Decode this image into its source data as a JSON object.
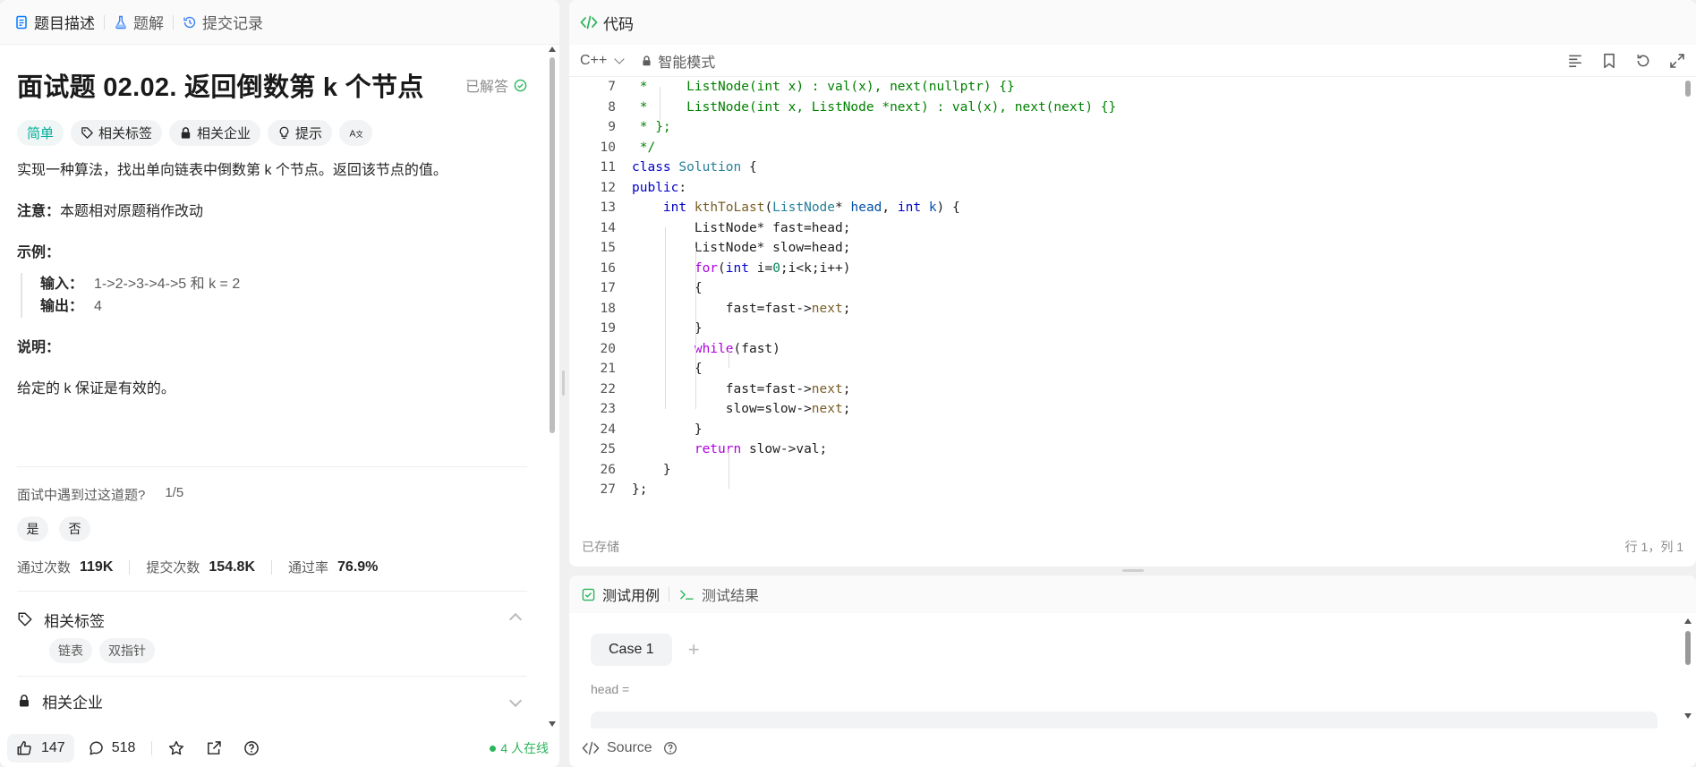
{
  "left_tabs": [
    {
      "label": "题目描述"
    },
    {
      "label": "题解"
    },
    {
      "label": "提交记录"
    }
  ],
  "problem": {
    "title": "面试题 02.02. 返回倒数第 k 个节点",
    "status": "已解答",
    "difficulty": "简单",
    "tags_label": "相关标签",
    "companies_label": "相关企业",
    "hint_label": "提示",
    "translate_label": "A文",
    "desc1": "实现一种算法，找出单向链表中倒数第 k 个节点。返回该节点的值。",
    "note_label": "注意：",
    "note_text": "本题相对原题稍作改动",
    "example_title": "示例：",
    "example_input_label": "输入：",
    "example_input": "1->2->3->4->5 和 k = 2",
    "example_output_label": "输出：",
    "example_output": "4",
    "explain_title": "说明：",
    "explain_text": "给定的 k 保证是有效的。"
  },
  "interview": {
    "question": "面试中遇到过这道题?",
    "progress": "1/5",
    "yes": "是",
    "no": "否"
  },
  "stats": {
    "accepted_label": "通过次数",
    "accepted": "119K",
    "submissions_label": "提交次数",
    "submissions": "154.8K",
    "rate_label": "通过率",
    "rate": "76.9%"
  },
  "related_tags": {
    "title": "相关标签",
    "items": [
      "链表",
      "双指针"
    ]
  },
  "related_companies": {
    "title": "相关企业"
  },
  "bottom_bar": {
    "likes": "147",
    "comments": "518",
    "online": "4 人在线"
  },
  "code_panel": {
    "title": "代码",
    "language": "C++",
    "mode": "智能模式",
    "saved": "已存储",
    "cursor": "行 1，列 1"
  },
  "code_lines": [
    {
      "n": "7"
    },
    {
      "n": "8"
    },
    {
      "n": "9"
    },
    {
      "n": "10"
    },
    {
      "n": "11"
    },
    {
      "n": "12"
    },
    {
      "n": "13"
    },
    {
      "n": "14"
    },
    {
      "n": "15"
    },
    {
      "n": "16"
    },
    {
      "n": "17"
    },
    {
      "n": "18"
    },
    {
      "n": "19"
    },
    {
      "n": "20"
    },
    {
      "n": "21"
    },
    {
      "n": "22"
    },
    {
      "n": "23"
    },
    {
      "n": "24"
    },
    {
      "n": "25"
    },
    {
      "n": "26"
    },
    {
      "n": "27"
    }
  ],
  "code": {
    "l7": " *     ListNode(int x) : val(x), next(nullptr) {}",
    "l8": " *     ListNode(int x, ListNode *next) : val(x), next(next) {}",
    "l9": " * };",
    "l10": " */",
    "l11_kw": "class",
    "l11_ty": "Solution",
    "l11_rest": " {",
    "l12_kw": "public",
    "l12_rest": ":",
    "l13_kw1": "int",
    "l13_fn": "kthToLast",
    "l13_ty": "ListNode",
    "l13_p1": "head",
    "l13_kw2": "int",
    "l13_p2": "k",
    "l14": "ListNode* fast=head;",
    "l15": "ListNode* slow=head;",
    "l16_ctl": "for",
    "l16_kw": "int",
    "l16_a": " i=",
    "l16_num": "0",
    "l16_b": ";i<k;i++)",
    "l17": "{",
    "l18_a": "fast=fast->",
    "l18_b": "next",
    "l18_c": ";",
    "l19": "}",
    "l20_ctl": "while",
    "l20_rest": "(fast)",
    "l21": "{",
    "l22_a": "fast=fast->",
    "l22_b": "next",
    "l22_c": ";",
    "l23_a": "slow=slow->",
    "l23_b": "next",
    "l23_c": ";",
    "l24": "}",
    "l25_ctl": "return",
    "l25_rest": " slow->val;",
    "l26": "}",
    "l27": "};"
  },
  "test_panel": {
    "tab_cases": "测试用例",
    "tab_results": "测试结果",
    "case_label": "Case 1",
    "add_label": "+",
    "input_label": "head =",
    "source_label": "Source"
  },
  "colors": {
    "easy": "#00af9b",
    "solved": "#2db55d",
    "comment": "#008000",
    "keyword": "#0000c8",
    "type": "#267f99",
    "control": "#af00db"
  }
}
